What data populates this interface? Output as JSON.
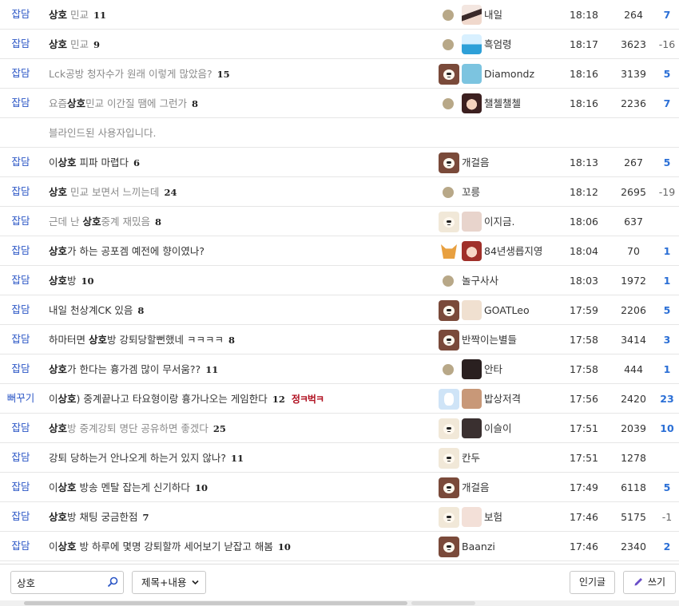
{
  "posts": [
    {
      "category": "잡담",
      "segments": [
        {
          "t": "상호",
          "hl": true
        },
        {
          "t": " 민교",
          "v": true
        }
      ],
      "comments": "11",
      "icon": "dot",
      "avatar": "av-a",
      "nick": "내일",
      "time": "18:18",
      "views": "264",
      "rec": "7"
    },
    {
      "category": "잡담",
      "segments": [
        {
          "t": "상호",
          "hl": true
        },
        {
          "t": " 민교",
          "v": true
        }
      ],
      "comments": "9",
      "icon": "dot",
      "avatar": "av-b",
      "nick": "흑엄령",
      "time": "18:17",
      "views": "3623",
      "rec": "-16"
    },
    {
      "category": "잡담",
      "segments": [
        {
          "t": "Lck공방 청자수가 원래 이렇게 많았음?",
          "v": true
        }
      ],
      "comments": "15",
      "icon": "dog-dark",
      "avatar": "av-c",
      "nick": "Diamondz",
      "time": "18:16",
      "views": "3139",
      "rec": "5"
    },
    {
      "category": "잡담",
      "segments": [
        {
          "t": "요즘",
          "v": true
        },
        {
          "t": "상호",
          "hl": true
        },
        {
          "t": "민교 이간질 땜에 그런가",
          "v": true
        }
      ],
      "comments": "8",
      "icon": "dot",
      "avatar": "av-d",
      "nick": "챌첼챌첼",
      "time": "18:16",
      "views": "2236",
      "rec": "7"
    },
    {
      "category": "",
      "segments": [
        {
          "t": "블라인드된 사용자입니다.",
          "v": true
        }
      ],
      "comments": "",
      "icon": "",
      "avatar": "",
      "nick": "",
      "time": "",
      "views": "",
      "rec": "",
      "blind": true
    },
    {
      "category": "잡담",
      "segments": [
        {
          "t": "이"
        },
        {
          "t": "상호",
          "hl": true
        },
        {
          "t": " 피파 마렵다"
        }
      ],
      "comments": "6",
      "icon": "dog-dark",
      "avatar": "",
      "nick": "개걸음",
      "time": "18:13",
      "views": "267",
      "rec": "5"
    },
    {
      "category": "잡담",
      "segments": [
        {
          "t": "상호",
          "hl": true
        },
        {
          "t": " 민교 보면서 느끼는데",
          "v": true
        }
      ],
      "comments": "24",
      "icon": "dot",
      "avatar": "",
      "nick": "꼬릉",
      "time": "18:12",
      "views": "2695",
      "rec": "-19"
    },
    {
      "category": "잡담",
      "segments": [
        {
          "t": "근데 난 ",
          "v": true
        },
        {
          "t": "상호",
          "hl": true
        },
        {
          "t": "중계 재밌음",
          "v": true
        }
      ],
      "comments": "8",
      "icon": "dog-light",
      "avatar": "av-e",
      "nick": "이지금.",
      "time": "18:06",
      "views": "637",
      "rec": ""
    },
    {
      "category": "잡담",
      "segments": [
        {
          "t": "상호",
          "hl": true
        },
        {
          "t": "가 하는 공포겜 예전에 향이였나?"
        }
      ],
      "comments": "",
      "icon": "dog-shiba",
      "avatar": "av-f",
      "nick": "84년생릅지영",
      "time": "18:04",
      "views": "70",
      "rec": "1"
    },
    {
      "category": "잡담",
      "segments": [
        {
          "t": "상호",
          "hl": true
        },
        {
          "t": "방"
        }
      ],
      "comments": "10",
      "icon": "dot",
      "avatar": "",
      "nick": "놀구사사",
      "time": "18:03",
      "views": "1972",
      "rec": "1"
    },
    {
      "category": "잡담",
      "segments": [
        {
          "t": "내일 천상계CK 있음"
        }
      ],
      "comments": "8",
      "icon": "dog-dark",
      "avatar": "av-g",
      "nick": "GOATLeo",
      "time": "17:59",
      "views": "2206",
      "rec": "5"
    },
    {
      "category": "잡담",
      "segments": [
        {
          "t": "하마터면 "
        },
        {
          "t": "상호",
          "hl": true
        },
        {
          "t": "방 강퇴당할뻔했네 ㅋㅋㅋㅋ"
        }
      ],
      "comments": "8",
      "icon": "dog-dark",
      "avatar": "",
      "nick": "반짝이는별들",
      "time": "17:58",
      "views": "3414",
      "rec": "3"
    },
    {
      "category": "잡담",
      "segments": [
        {
          "t": "상호",
          "hl": true
        },
        {
          "t": "가 한다는 흉가겜 많이 무서움??"
        }
      ],
      "comments": "11",
      "icon": "dot",
      "avatar": "av-i",
      "nick": "안타",
      "time": "17:58",
      "views": "444",
      "rec": "1"
    },
    {
      "category": "뻐꾸기",
      "segments": [
        {
          "t": "이"
        },
        {
          "t": "상호",
          "hl": true
        },
        {
          "t": ") 중계끝나고 타요형이랑 흉가나오는 게임한다"
        }
      ],
      "comments": "12",
      "tag": "정ㅋ벅ㅋ",
      "icon": "dog-blue",
      "avatar": "av-j",
      "nick": "밥상저격",
      "time": "17:56",
      "views": "2420",
      "rec": "23"
    },
    {
      "category": "잡담",
      "segments": [
        {
          "t": "상호",
          "hl": true
        },
        {
          "t": "방 중계강퇴 명단 공유하면 좋겠다",
          "v": true
        }
      ],
      "comments": "25",
      "icon": "dog-light",
      "avatar": "av-k",
      "nick": "이슬이",
      "time": "17:51",
      "views": "2039",
      "rec": "10"
    },
    {
      "category": "잡담",
      "segments": [
        {
          "t": "강퇴 당하는거 안나오게 하는거 있지 않나?"
        }
      ],
      "comments": "11",
      "icon": "dog-light",
      "avatar": "",
      "nick": "칸두",
      "time": "17:51",
      "views": "1278",
      "rec": ""
    },
    {
      "category": "잡담",
      "segments": [
        {
          "t": "이"
        },
        {
          "t": "상호",
          "hl": true
        },
        {
          "t": " 방송 멘탈 잡는게 신기하다"
        }
      ],
      "comments": "10",
      "icon": "dog-dark",
      "avatar": "",
      "nick": "개걸음",
      "time": "17:49",
      "views": "6118",
      "rec": "5"
    },
    {
      "category": "잡담",
      "segments": [
        {
          "t": "상호",
          "hl": true
        },
        {
          "t": "방 채팅 궁금한점"
        }
      ],
      "comments": "7",
      "icon": "dog-light",
      "avatar": "av-l",
      "nick": "보험",
      "time": "17:46",
      "views": "5175",
      "rec": "-1"
    },
    {
      "category": "잡담",
      "segments": [
        {
          "t": "이"
        },
        {
          "t": "상호",
          "hl": true
        },
        {
          "t": " 방 하루에 몇명 강퇴할까 세어보기 낟잡고 해봄"
        }
      ],
      "comments": "10",
      "icon": "dog-dark",
      "avatar": "",
      "nick": "Baanzi",
      "time": "17:46",
      "views": "2340",
      "rec": "2"
    }
  ],
  "footer": {
    "search_value": "상호",
    "search_type": "제목+내용",
    "popular_label": "인기글",
    "write_label": "쓰기"
  },
  "colors": {
    "category": "#2b56c6",
    "recommend_positive": "#2b6fd6",
    "tag_red": "#b01020"
  }
}
